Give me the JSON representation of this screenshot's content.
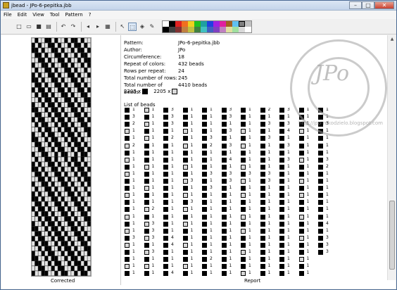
{
  "window": {
    "title": "jbead - JPo-6-pepitka.jbb",
    "controls": [
      "–",
      "□",
      "✕"
    ]
  },
  "menu": [
    "File",
    "Edit",
    "View",
    "Tool",
    "Pattern",
    "?"
  ],
  "toolbar": [
    {
      "name": "new-icon",
      "glyph": "□"
    },
    {
      "name": "open-icon",
      "glyph": "▭"
    },
    {
      "name": "save-icon",
      "glyph": "■"
    },
    {
      "name": "print-icon",
      "glyph": "▤"
    },
    {
      "name": "undo-icon",
      "glyph": "↶"
    },
    {
      "name": "redo-icon",
      "glyph": "↷"
    },
    {
      "name": "arrow-left-icon",
      "glyph": "◂"
    },
    {
      "name": "arrow-right-icon",
      "glyph": "▸"
    },
    {
      "name": "grid-icon",
      "glyph": "▦"
    },
    {
      "name": "pointer-icon",
      "glyph": "↖"
    },
    {
      "name": "select-icon",
      "glyph": "⬚"
    },
    {
      "name": "fill-icon",
      "glyph": "◈"
    },
    {
      "name": "pipette-icon",
      "glyph": "✎"
    }
  ],
  "palette": [
    "#ffffff",
    "#000000",
    "#e02020",
    "#f07020",
    "#f0d020",
    "#20c020",
    "#20a0a0",
    "#2040e0",
    "#a020e0",
    "#e020a0",
    "#a06020",
    "#60c0f0",
    "#808080",
    "#c0c0c0",
    "#000000",
    "#404040",
    "#803030",
    "#c08040",
    "#c0c040",
    "#408040",
    "#40c0c0",
    "#4060c0",
    "#8040c0",
    "#c080c0",
    "#e0e0a0",
    "#a0e0a0",
    "#d8d8d8",
    "#ffffff"
  ],
  "selected_swatch": 12,
  "info": [
    {
      "k": "Pattern:",
      "v": "JPo-6-pepitka.jbb"
    },
    {
      "k": "Author:",
      "v": "JPo"
    },
    {
      "k": "Circumference:",
      "v": "18"
    },
    {
      "k": "Repeat of colors:",
      "v": "432 beads"
    },
    {
      "k": "Rows per repeat:",
      "v": "24"
    },
    {
      "k": "Total number of rows:",
      "v": "245"
    },
    {
      "k": "Total number of beads:",
      "v": "4410 beads"
    }
  ],
  "counts": [
    {
      "label": "2205 x",
      "color": "#000000"
    },
    {
      "label": "2205 x",
      "color": "#d8d8d8"
    }
  ],
  "list_title": "List of beads",
  "labels": {
    "corrected": "Corrected",
    "report": "Report"
  },
  "watermark": {
    "text": "JPo",
    "url": "http://jpo-rekodzielo.blogspot.com"
  },
  "bead_columns": [
    [
      [
        1,
        1
      ],
      [
        1,
        3
      ],
      [
        1,
        2
      ],
      [
        0,
        1
      ],
      [
        1,
        1
      ],
      [
        0,
        2
      ],
      [
        1,
        1
      ],
      [
        0,
        1
      ],
      [
        1,
        1
      ],
      [
        0,
        1
      ],
      [
        1,
        1
      ],
      [
        1,
        1
      ],
      [
        0,
        1
      ],
      [
        1,
        1
      ],
      [
        1,
        1
      ],
      [
        0,
        1
      ],
      [
        1,
        1
      ],
      [
        0,
        1
      ],
      [
        1,
        3
      ],
      [
        0,
        1
      ],
      [
        1,
        1
      ],
      [
        1,
        1
      ],
      [
        0,
        1
      ],
      [
        1,
        1
      ]
    ],
    [
      [
        0,
        1
      ],
      [
        1,
        1
      ],
      [
        0,
        1
      ],
      [
        1,
        1
      ],
      [
        0,
        1
      ],
      [
        1,
        1
      ],
      [
        1,
        1
      ],
      [
        1,
        1
      ],
      [
        0,
        1
      ],
      [
        1,
        1
      ],
      [
        1,
        1
      ],
      [
        0,
        1
      ],
      [
        1,
        1
      ],
      [
        1,
        1
      ],
      [
        0,
        2
      ],
      [
        1,
        1
      ],
      [
        0,
        3
      ],
      [
        1,
        3
      ],
      [
        0,
        3
      ],
      [
        1,
        1
      ],
      [
        0,
        3
      ],
      [
        1,
        1
      ],
      [
        0,
        1
      ],
      [
        1,
        1
      ]
    ],
    [
      [
        1,
        3
      ],
      [
        1,
        3
      ],
      [
        1,
        3
      ],
      [
        1,
        1
      ],
      [
        1,
        2
      ],
      [
        1,
        1
      ],
      [
        1,
        1
      ],
      [
        1,
        1
      ],
      [
        1,
        1
      ],
      [
        1,
        1
      ],
      [
        1,
        1
      ],
      [
        1,
        1
      ],
      [
        1,
        1
      ],
      [
        1,
        1
      ],
      [
        1,
        1
      ],
      [
        1,
        1
      ],
      [
        1,
        1
      ],
      [
        1,
        1
      ],
      [
        1,
        4
      ],
      [
        1,
        4
      ],
      [
        1,
        1
      ],
      [
        1,
        1
      ],
      [
        1,
        1
      ],
      [
        1,
        4
      ]
    ],
    [
      [
        1,
        1
      ],
      [
        1,
        1
      ],
      [
        1,
        1
      ],
      [
        0,
        1
      ],
      [
        1,
        1
      ],
      [
        0,
        1
      ],
      [
        1,
        1
      ],
      [
        1,
        1
      ],
      [
        0,
        1
      ],
      [
        1,
        1
      ],
      [
        0,
        3
      ],
      [
        1,
        1
      ],
      [
        0,
        1
      ],
      [
        1,
        3
      ],
      [
        0,
        1
      ],
      [
        1,
        1
      ],
      [
        0,
        1
      ],
      [
        1,
        1
      ],
      [
        1,
        1
      ],
      [
        0,
        1
      ],
      [
        1,
        1
      ],
      [
        1,
        1
      ],
      [
        0,
        1
      ],
      [
        1,
        1
      ]
    ],
    [
      [
        1,
        1
      ],
      [
        1,
        1
      ],
      [
        1,
        1
      ],
      [
        1,
        1
      ],
      [
        1,
        3
      ],
      [
        1,
        2
      ],
      [
        1,
        1
      ],
      [
        1,
        1
      ],
      [
        1,
        1
      ],
      [
        1,
        3
      ],
      [
        1,
        1
      ],
      [
        1,
        3
      ],
      [
        1,
        1
      ],
      [
        1,
        1
      ],
      [
        1,
        1
      ],
      [
        1,
        1
      ],
      [
        1,
        1
      ],
      [
        1,
        1
      ],
      [
        1,
        1
      ],
      [
        1,
        1
      ],
      [
        1,
        1
      ],
      [
        1,
        2
      ],
      [
        1,
        1
      ],
      [
        1,
        1
      ]
    ],
    [
      [
        1,
        3
      ],
      [
        1,
        3
      ],
      [
        1,
        1
      ],
      [
        1,
        3
      ],
      [
        1,
        1
      ],
      [
        1,
        3
      ],
      [
        1,
        1
      ],
      [
        1,
        4
      ],
      [
        1,
        1
      ],
      [
        1,
        3
      ],
      [
        1,
        3
      ],
      [
        1,
        1
      ],
      [
        1,
        1
      ],
      [
        1,
        1
      ],
      [
        1,
        1
      ],
      [
        1,
        1
      ],
      [
        1,
        1
      ],
      [
        1,
        1
      ],
      [
        1,
        1
      ],
      [
        1,
        1
      ],
      [
        1,
        1
      ],
      [
        1,
        1
      ],
      [
        1,
        1
      ],
      [
        1,
        1
      ]
    ],
    [
      [
        1,
        1
      ],
      [
        1,
        1
      ],
      [
        1,
        1
      ],
      [
        0,
        1
      ],
      [
        1,
        1
      ],
      [
        0,
        1
      ],
      [
        1,
        1
      ],
      [
        1,
        1
      ],
      [
        0,
        1
      ],
      [
        1,
        3
      ],
      [
        0,
        1
      ],
      [
        1,
        1
      ],
      [
        0,
        1
      ],
      [
        1,
        1
      ],
      [
        1,
        1
      ],
      [
        0,
        1
      ],
      [
        1,
        1
      ],
      [
        0,
        1
      ],
      [
        1,
        1
      ],
      [
        1,
        1
      ],
      [
        0,
        1
      ],
      [
        1,
        1
      ],
      [
        1,
        1
      ],
      [
        0,
        1
      ]
    ],
    [
      [
        1,
        2
      ],
      [
        1,
        1
      ],
      [
        1,
        3
      ],
      [
        1,
        1
      ],
      [
        1,
        3
      ],
      [
        1,
        1
      ],
      [
        1,
        1
      ],
      [
        1,
        1
      ],
      [
        1,
        1
      ],
      [
        1,
        3
      ],
      [
        1,
        3
      ],
      [
        1,
        1
      ],
      [
        1,
        1
      ],
      [
        1,
        1
      ],
      [
        1,
        1
      ],
      [
        1,
        1
      ],
      [
        1,
        1
      ],
      [
        1,
        1
      ],
      [
        1,
        1
      ],
      [
        1,
        1
      ],
      [
        1,
        1
      ],
      [
        1,
        1
      ],
      [
        1,
        1
      ],
      [
        1,
        1
      ]
    ],
    [
      [
        1,
        3
      ],
      [
        1,
        1
      ],
      [
        1,
        3
      ],
      [
        1,
        4
      ],
      [
        1,
        1
      ],
      [
        1,
        3
      ],
      [
        1,
        1
      ],
      [
        1,
        3
      ],
      [
        1,
        1
      ],
      [
        1,
        1
      ],
      [
        1,
        1
      ],
      [
        1,
        1
      ],
      [
        1,
        1
      ],
      [
        1,
        1
      ],
      [
        1,
        1
      ],
      [
        1,
        1
      ],
      [
        1,
        1
      ],
      [
        1,
        1
      ],
      [
        1,
        1
      ],
      [
        1,
        1
      ],
      [
        1,
        1
      ],
      [
        1,
        1
      ],
      [
        1,
        1
      ],
      [
        1,
        1
      ]
    ],
    [
      [
        1,
        1
      ],
      [
        1,
        1
      ],
      [
        1,
        1
      ],
      [
        0,
        1
      ],
      [
        1,
        1
      ],
      [
        1,
        1
      ],
      [
        1,
        1
      ],
      [
        0,
        1
      ],
      [
        1,
        1
      ],
      [
        1,
        1
      ],
      [
        0,
        1
      ],
      [
        1,
        1
      ],
      [
        0,
        1
      ],
      [
        1,
        1
      ],
      [
        1,
        1
      ],
      [
        0,
        1
      ],
      [
        1,
        1
      ],
      [
        1,
        1
      ],
      [
        0,
        1
      ],
      [
        1,
        1
      ],
      [
        1,
        1
      ],
      [
        0,
        1
      ],
      [
        1,
        1
      ],
      [
        1,
        1
      ]
    ],
    [
      [
        1,
        1
      ],
      [
        1,
        1
      ],
      [
        1,
        3
      ],
      [
        1,
        1
      ],
      [
        1,
        1
      ],
      [
        1,
        1
      ],
      [
        1,
        1
      ],
      [
        1,
        3
      ],
      [
        1,
        2
      ],
      [
        1,
        1
      ],
      [
        1,
        1
      ],
      [
        1,
        1
      ],
      [
        1,
        1
      ],
      [
        1,
        1
      ],
      [
        1,
        1
      ],
      [
        1,
        1
      ],
      [
        1,
        4
      ],
      [
        1,
        1
      ],
      [
        1,
        3
      ],
      [
        1,
        3
      ],
      [
        1,
        3
      ]
    ]
  ],
  "pattern_grid": {
    "columns": 18,
    "rows": 48,
    "repeat": [
      "010011010010110100",
      "101001101001011010",
      "110100110100101101",
      "011010011010010110",
      "001101001101001011",
      "100110100110100101",
      "010011010011010010",
      "101001101001101001",
      "110100110100110100",
      "011010011010011010",
      "101101001101001101",
      "010110100110100110",
      "001011010011010011",
      "100101101001101001",
      "110010110100110100",
      "011001011010011010",
      "101100101101001101",
      "010110010110100110",
      "001011001011010011",
      "100101100101101001",
      "110010110010110100",
      "011001011001011010",
      "001100101100101101",
      "100110010110010110"
    ]
  }
}
